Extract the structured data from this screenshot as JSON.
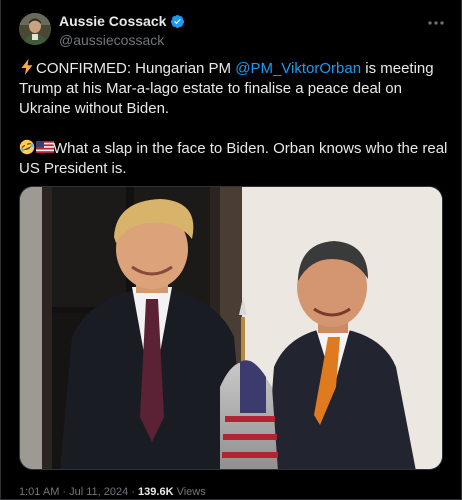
{
  "author": {
    "display_name": "Aussie Cossack",
    "handle": "@aussiecossack"
  },
  "tweet": {
    "line1_prefix": "CONFIRMED: Hungarian PM ",
    "mention": "@PM_ViktorOrban",
    "line1_suffix": " is meeting Trump at his Mar-a-lago estate to finalise a peace deal on Ukraine without Biden.",
    "line2": "What a slap in the face to Biden. Orban knows who the real US President is."
  },
  "meta": {
    "time": "1:01 AM",
    "sep1": " · ",
    "date": "Jul 11, 2024",
    "sep2": " · ",
    "views_count": "139.6K",
    "views_label": " Views"
  },
  "icons": {
    "verified": "verified-badge-icon",
    "more": "more-options-icon",
    "lightning": "lightning-emoji",
    "laughing": "rolling-laughing-emoji",
    "flag": "us-flag-emoji"
  },
  "colors": {
    "background": "#000000",
    "text": "#e7e9ea",
    "secondary": "#71767b",
    "link": "#1d9bf0",
    "border": "#2f3336"
  }
}
